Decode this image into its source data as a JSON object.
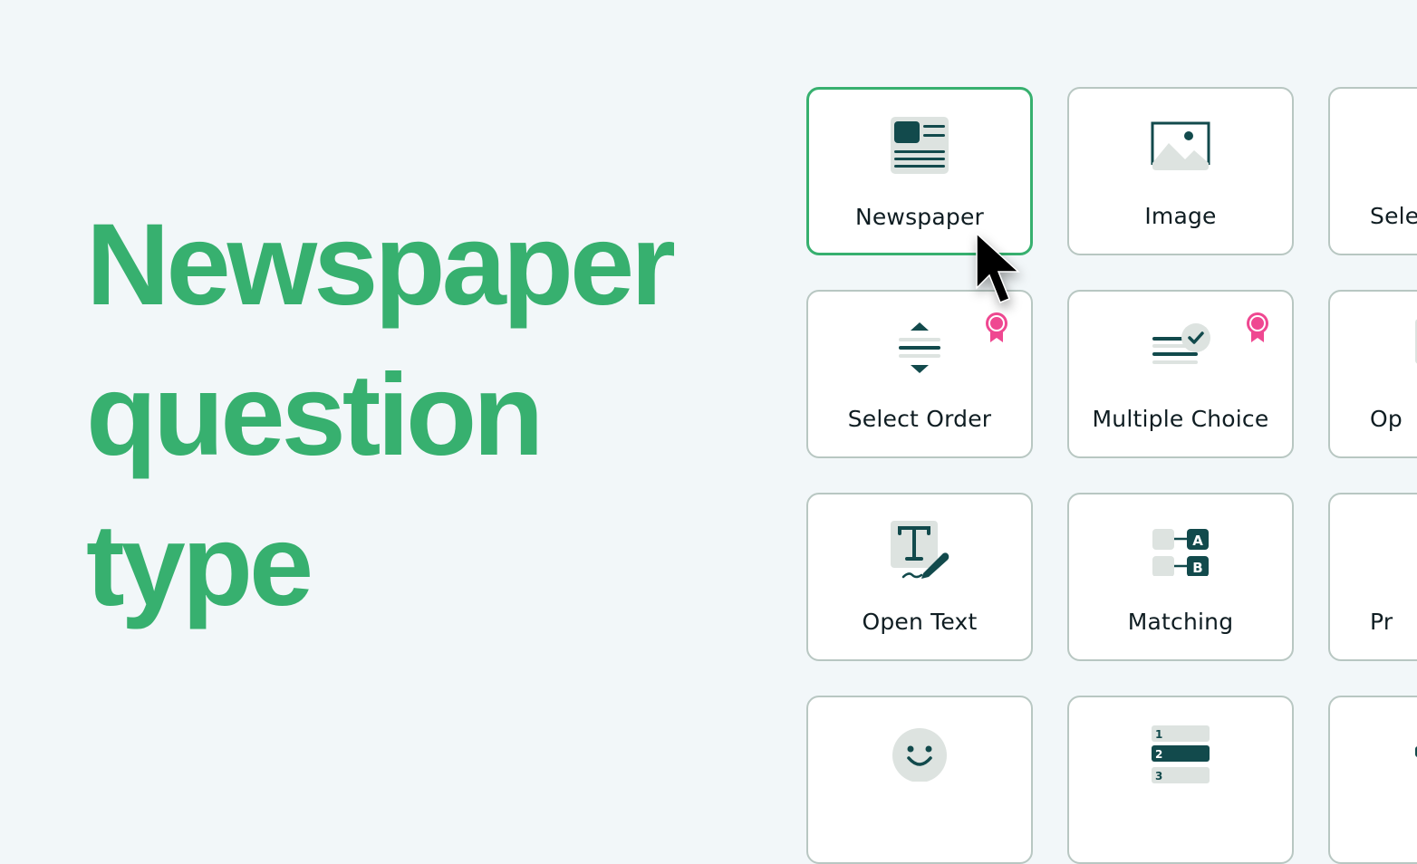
{
  "headline": {
    "lines": [
      "Newspaper",
      "question",
      "type"
    ]
  },
  "colors": {
    "accent": "#37b06f",
    "icon_dark": "#124a4c",
    "icon_light": "#dde3e0",
    "badge": "#ef4891",
    "card_border": "#b8c7c2",
    "background": "#f2f7f9"
  },
  "question_types": [
    {
      "label": "Newspaper",
      "icon": "newspaper-icon",
      "selected": true,
      "premium": false
    },
    {
      "label": "Image",
      "icon": "image-icon",
      "selected": false,
      "premium": false
    },
    {
      "label": "Sele",
      "icon": "select-icon",
      "selected": false,
      "premium": false,
      "clipped": true
    },
    {
      "label": "Select Order",
      "icon": "select-order-icon",
      "selected": false,
      "premium": true
    },
    {
      "label": "Multiple Choice",
      "icon": "multiple-choice-icon",
      "selected": false,
      "premium": true
    },
    {
      "label": "Op",
      "icon": "unknown-icon",
      "selected": false,
      "premium": false,
      "clipped": true
    },
    {
      "label": "Open Text",
      "icon": "open-text-icon",
      "selected": false,
      "premium": false
    },
    {
      "label": "Matching",
      "icon": "matching-icon",
      "selected": false,
      "premium": false
    },
    {
      "label": "Pr",
      "icon": "unknown-icon",
      "selected": false,
      "premium": false,
      "clipped": true
    },
    {
      "label": "",
      "icon": "smiley-icon",
      "selected": false,
      "premium": false
    },
    {
      "label": "",
      "icon": "ranking-icon",
      "selected": false,
      "premium": false
    },
    {
      "label": "",
      "icon": "ranking-icon",
      "selected": false,
      "premium": false,
      "clipped": true
    }
  ],
  "icon_text": {
    "matching_a": "A",
    "matching_b": "B",
    "ranking": [
      "1",
      "2",
      "3"
    ]
  }
}
